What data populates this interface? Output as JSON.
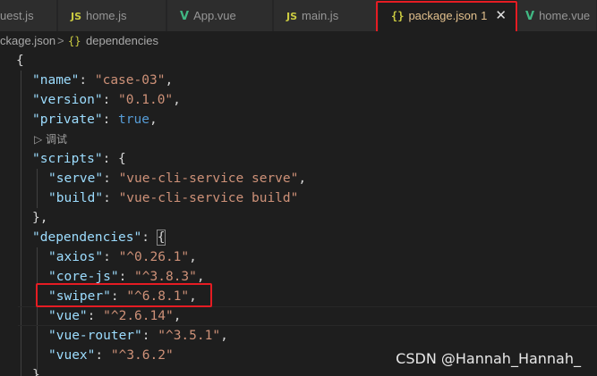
{
  "tabs": [
    {
      "label": "uest.js",
      "icon": "",
      "kind": "js"
    },
    {
      "label": "home.js",
      "icon": "JS",
      "kind": "js"
    },
    {
      "label": "App.vue",
      "icon": "V",
      "kind": "vue"
    },
    {
      "label": "main.js",
      "icon": "JS",
      "kind": "js"
    },
    {
      "label": "package.json",
      "icon": "{}",
      "kind": "json",
      "count": "1",
      "close": "✕"
    },
    {
      "label": "home.vue",
      "icon": "V",
      "kind": "vue"
    }
  ],
  "breadcrumb": {
    "file": "ckage.json",
    "separator": ">",
    "symbol_icon": "{}",
    "symbol": "dependencies"
  },
  "code": {
    "open_brace": "{",
    "name_key": "\"name\"",
    "name_val": "\"case-03\"",
    "version_key": "\"version\"",
    "version_val": "\"0.1.0\"",
    "private_key": "\"private\"",
    "private_val": "true",
    "codelens": "▷ 调试",
    "scripts_key": "\"scripts\"",
    "serve_key": "\"serve\"",
    "serve_val": "\"vue-cli-service serve\"",
    "build_key": "\"build\"",
    "build_val": "\"vue-cli-service build\"",
    "scripts_close": "},",
    "deps_key": "\"dependencies\"",
    "axios_key": "\"axios\"",
    "axios_val": "\"^0.26.1\"",
    "corejs_key": "\"core-js\"",
    "corejs_val": "\"^3.8.3\"",
    "swiper_key": "\"swiper\"",
    "swiper_val": "\"^6.8.1\"",
    "vue_key": "\"vue\"",
    "vue_val": "\"^2.6.14\"",
    "router_key": "\"vue-router\"",
    "router_val": "\"^3.5.1\"",
    "vuex_key": "\"vuex\"",
    "vuex_val": "\"^3.6.2\"",
    "deps_close": "}"
  },
  "watermark": "CSDN @Hannah_Hannah_",
  "colors": {
    "highlight": "#e51c23",
    "string": "#ce9178",
    "key": "#9cdcfe",
    "boolean": "#569cd6"
  }
}
